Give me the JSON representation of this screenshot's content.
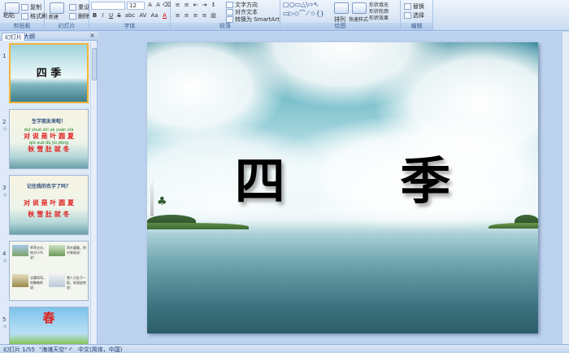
{
  "ribbon": {
    "clipboard": {
      "paste": "粘贴",
      "copy": "复制",
      "format_painter": "格式刷",
      "group": "剪贴板"
    },
    "slides": {
      "new_slide": "新建\n幻灯片",
      "reset": "重设",
      "delete": "删除",
      "group": "幻灯片"
    },
    "font": {
      "size": "12",
      "group": "字体",
      "bold": "B",
      "italic": "I",
      "underline": "U",
      "strike": "S",
      "shadow": "abc",
      "spacing": "AV",
      "case": "Aa",
      "color": "A"
    },
    "paragraph": {
      "text_direction": "文字方向",
      "align_text": "对齐文本",
      "convert_smartart": "转换为 SmartArt",
      "group": "段落"
    },
    "drawing": {
      "arrange": "排列",
      "quick_styles": "快速样式",
      "shape_fill": "形状填充",
      "shape_outline": "形状轮廓",
      "shape_effects": "形状效果",
      "group": "绘图"
    },
    "editing": {
      "find": "替换",
      "replace": "替换",
      "select": "选择",
      "group": "编辑"
    }
  },
  "pane": {
    "tab_slides": "幻灯片",
    "tab_outline": "大纲",
    "close": "×",
    "thumbnails": [
      {
        "num": "1",
        "title": "四  季"
      },
      {
        "num": "2",
        "title": "生字朋友来啦！",
        "row1": "对 说 是 叶 圆 夏",
        "row2": "秋 雪 肚 就 冬",
        "pinyin1": "duì shuō shì yè yuán xià",
        "pinyin2": "qiū xuě dù jiù dōng"
      },
      {
        "num": "3",
        "title": "记住我的名字了吗？",
        "row1": "对 说 是 叶 圆 夏",
        "row2": "秋 雪 肚 就 冬"
      },
      {
        "num": "4",
        "captions": [
          "草芽尖尖，他对小鸟说：",
          "荷叶圆圆，他对青蛙说：",
          "谷穗弯弯，他鞠着躬说：",
          "雪人大肚子一挺，他顽皮地说："
        ]
      },
      {
        "num": "5",
        "title": "春"
      }
    ]
  },
  "slide": {
    "title": "四    季"
  },
  "statusbar": {
    "slide_count": "幻灯片 1/55",
    "theme": "\"海滩天空\"",
    "language": "中文(简体，中国)"
  }
}
